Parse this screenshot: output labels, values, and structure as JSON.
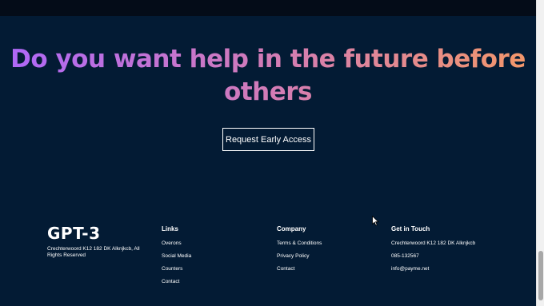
{
  "cta": {
    "heading_line1": "Do you want help in the future before",
    "heading_line2": "others",
    "button_label": "Request Early Access"
  },
  "footer": {
    "logo": "GPT-3",
    "address": "Crechterwoord K12 182 DK Alknjkcb, All Rights Reserved",
    "columns": {
      "links": {
        "title": "Links",
        "items": [
          "Overons",
          "Social Media",
          "Counters",
          "Contact"
        ]
      },
      "company": {
        "title": "Company",
        "items": [
          "Terms & Conditions",
          "Privacy Policy",
          "Contact"
        ]
      },
      "contact": {
        "title": "Get in Touch",
        "items": [
          "Crechterwoord K12 182 DK Alknjkcb",
          "085-132567",
          "info@payme.net"
        ]
      }
    }
  },
  "colors": {
    "background": "#031b34",
    "gradient_start": "#ae67fa",
    "gradient_end": "#f49867"
  }
}
